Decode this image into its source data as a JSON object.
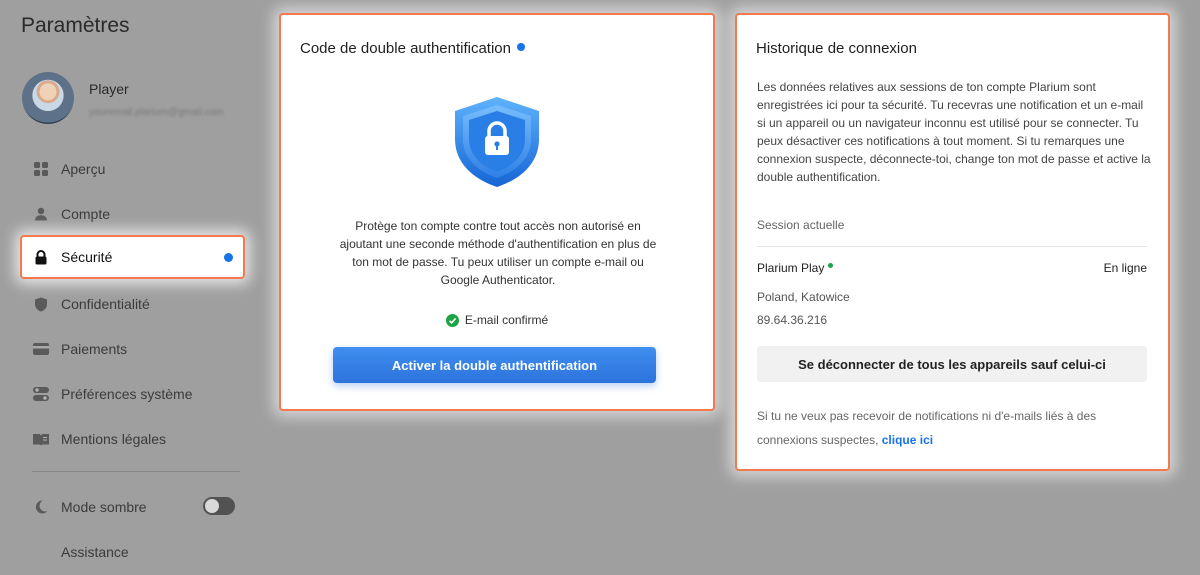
{
  "sidebar": {
    "title": "Paramètres",
    "profile": {
      "name": "Player",
      "email": "youremail.plarium@gmail.com"
    },
    "items": [
      {
        "label": "Aperçu",
        "icon": "grid-icon"
      },
      {
        "label": "Compte",
        "icon": "user-icon"
      },
      {
        "label": "Sécurité",
        "icon": "lock-icon",
        "active": true
      },
      {
        "label": "Confidentialité",
        "icon": "shield-icon"
      },
      {
        "label": "Paiements",
        "icon": "credit-card-icon"
      },
      {
        "label": "Préférences système",
        "icon": "toggles-icon"
      },
      {
        "label": "Mentions légales",
        "icon": "book-icon"
      }
    ],
    "dark_mode_label": "Mode sombre",
    "dark_mode_on": false,
    "support_label": "Assistance"
  },
  "two_factor": {
    "title": "Code de double authentification",
    "description": "Protège ton compte contre tout accès non autorisé en ajoutant une seconde méthode d'authentification en plus de ton mot de passe. Tu peux utiliser un compte e-mail ou Google Authenticator.",
    "status": "E-mail confirmé",
    "button_label": "Activer la double authentification"
  },
  "login_history": {
    "title": "Historique de connexion",
    "description": "Les données relatives aux sessions de ton compte Plarium sont enregistrées ici pour ta sécurité. Tu recevras une notification et un e-mail si un appareil ou un navigateur inconnu est utilisé pour se connecter. Tu peux désactiver ces notifications à tout moment. Si tu remarques une connexion suspecte, déconnecte-toi, change ton mot de passe et active la double authentification.",
    "session_label": "Session actuelle",
    "session": {
      "device": "Plarium Play",
      "status": "En ligne",
      "location": "Poland, Katowice",
      "ip": "89.64.36.216"
    },
    "logout_button_label": "Se déconnecter de tous les appareils sauf celui-ci",
    "footer_text": "Si tu ne veux pas recevoir de notifications ni d'e-mails liés à des connexions suspectes,",
    "footer_link": "clique ici"
  },
  "colors": {
    "accent": "#1773e8",
    "highlight_border": "#f47a4d",
    "success": "#1ea446",
    "overlay": "#9f9f9f"
  }
}
